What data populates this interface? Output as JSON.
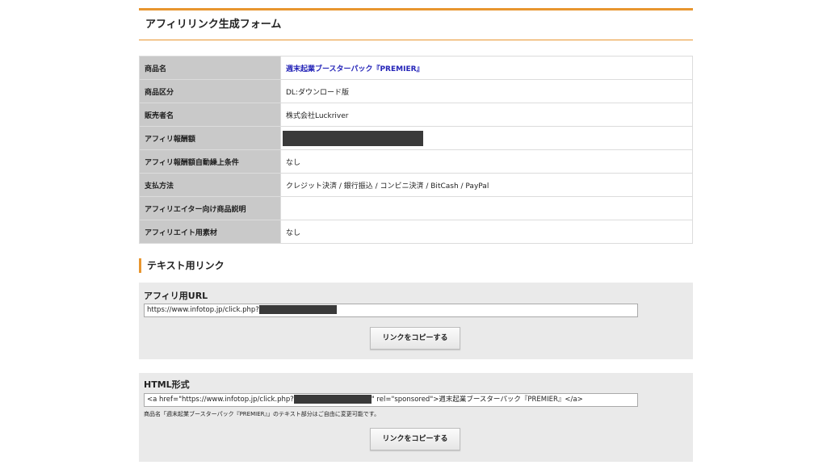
{
  "form_title": "アフィリリンク生成フォーム",
  "info_rows": [
    {
      "label": "商品名",
      "value": "週末起業ブースターパック『PREMIER』",
      "link": true
    },
    {
      "label": "商品区分",
      "value": "DL:ダウンロード版"
    },
    {
      "label": "販売者名",
      "value": "株式会社Luckriver"
    },
    {
      "label": "アフィリ報酬額",
      "value": "",
      "redacted": true
    },
    {
      "label": "アフィリ報酬額自動繰上条件",
      "value": "なし"
    },
    {
      "label": "支払方法",
      "value": "クレジット決済 / 銀行振込 / コンビニ決済 / BitCash / PayPal"
    },
    {
      "label": "アフィリエイター向け商品説明",
      "value": ""
    },
    {
      "label": "アフィリエイト用素材",
      "value": "なし"
    }
  ],
  "text_link_section": {
    "heading": "テキスト用リンク",
    "url_panel": {
      "title": "アフィリ用URL",
      "value_prefix": "https://www.infotop.jp/click.php?",
      "copy_label": "リンクをコピーする"
    },
    "html_panel": {
      "title": "HTML形式",
      "value_prefix": "<a href=\"https://www.infotop.jp/click.php?",
      "value_suffix": "\" rel=\"sponsored\">週末起業ブースターパック『PREMIER』</a>",
      "note": "商品名「週末起業ブースターパック『PREMIER』」のテキスト部分はご自由に変更可能です。",
      "copy_label": "リンクをコピーする"
    }
  },
  "colors": {
    "accent": "#e8962f",
    "label_bg": "#c9c9c9",
    "panel_bg": "#eaeaea",
    "link": "#2424b8"
  }
}
